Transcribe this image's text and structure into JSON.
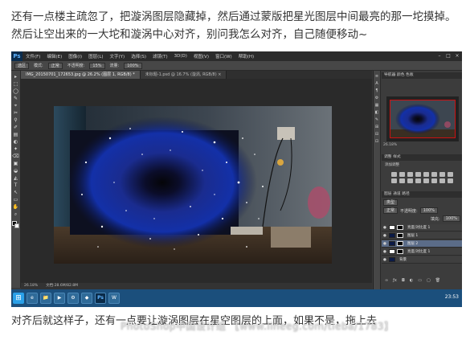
{
  "caption_top": "还有一点楼主疏忽了，把漩涡图层隐藏掉，然后通过蒙版把星光图层中间最亮的那一坨摸掉。然后让空出来的一大坨和漩涡中心对齐，别问我怎么对齐，自己随便移动~",
  "caption_bottom": "对齐后就这样子，还有一点要让漩涡图层在星空图层的上面，如果不是，拖上去",
  "watermark": "PhotoShop中国设计组 【www.lineeg.com/tieba/1783】",
  "ps": {
    "app_logo": "Ps",
    "menu": [
      "文件(F)",
      "编辑(E)",
      "图像(I)",
      "图层(L)",
      "文字(Y)",
      "选择(S)",
      "滤镜(T)",
      "3D(D)",
      "视图(V)",
      "窗口(W)",
      "帮助(H)"
    ],
    "window_controls": [
      "–",
      "□",
      "×"
    ],
    "options": {
      "preset_label": "选区",
      "mode_label": "模式:",
      "mode_value": "正常",
      "opacity_label": "不透明度:",
      "opacity_value": "15%",
      "flow_label": "流量:",
      "flow_value": "100%"
    },
    "tabs": [
      {
        "label": "IMG_20150701_172653.jpg @ 26.2% (图层 1, RGB/8) *",
        "active": true
      },
      {
        "label": "未标题-1.psd @ 16.7% (漩涡, RGB/8) ×",
        "active": false
      }
    ],
    "tools": [
      "▸",
      "⬚",
      "◯",
      "✎",
      "⌖",
      "✂",
      "⚲",
      "✐",
      "▤",
      "◐",
      "✦",
      "⌫",
      "▣",
      "◒",
      "◭",
      "T",
      "↖",
      "▭",
      "✋",
      "⌕"
    ],
    "status": {
      "zoom": "26.18%",
      "doc": "文档:28.6M/82.8M"
    },
    "panel_strip_icons": [
      "≡",
      "A",
      "¶",
      "⚙",
      "▦",
      "◧",
      "✎",
      "⊞",
      "⊟",
      "⊡"
    ],
    "navigator_header": "导航器  颜色  色板",
    "adjustments_header": "调整  样式",
    "adjustments_title": "添加调整",
    "layers_header": "图层  通道  路径",
    "layers_kind": "类型",
    "layers_blend": "正常",
    "layers_opacity_label": "不透明度:",
    "layers_opacity": "100%",
    "layers_fill_label": "填充:",
    "layers_fill": "100%",
    "navigator_zoom": "26.18%",
    "layers": [
      {
        "name": "亮度/对比度 1",
        "thumb": "white",
        "selected": false
      },
      {
        "name": "图层 1",
        "thumb": "dark",
        "selected": false
      },
      {
        "name": "图层 2",
        "thumb": "dark",
        "selected": true
      },
      {
        "name": "亮度/对比度 1",
        "thumb": "white",
        "selected": false
      },
      {
        "name": "背景",
        "thumb": "dark",
        "selected": false
      }
    ],
    "taskbar_icons": [
      "e",
      "📁",
      "▶",
      "⚙",
      "◆",
      "Ps",
      "W"
    ],
    "clock": "23:53"
  }
}
